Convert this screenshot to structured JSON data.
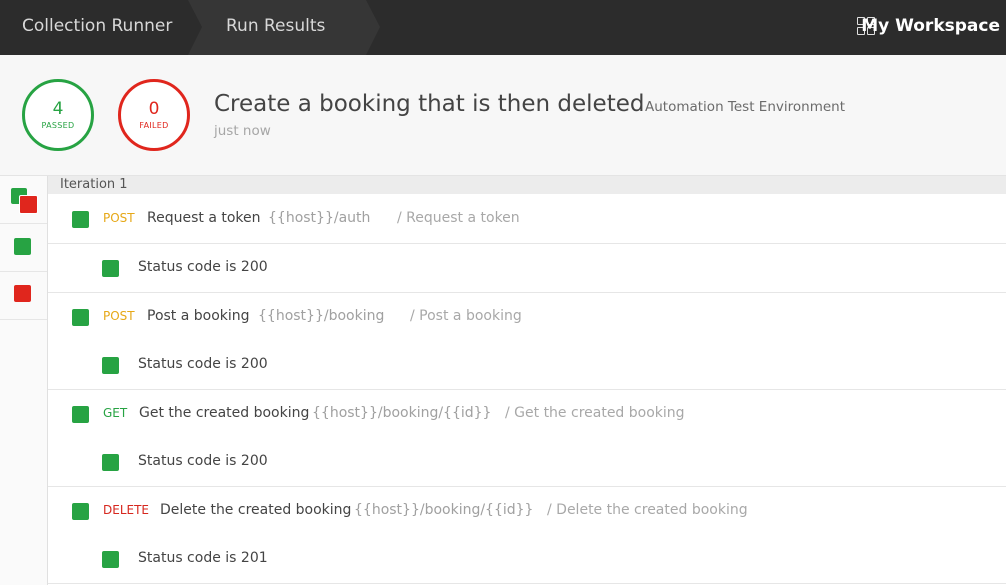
{
  "topbar": {
    "crumbs": [
      "Collection Runner",
      "Run Results"
    ],
    "workspace_icon": "grid-icon",
    "workspace": "My Workspace"
  },
  "summary": {
    "passed_count": "4",
    "passed_label": "PASSED",
    "failed_count": "0",
    "failed_label": "FAILED",
    "title": "Create a booking that is then deleted",
    "environment": "Automation Test Environment",
    "time": "just now"
  },
  "sidebar": {
    "iterations": [
      {
        "status": "passed"
      },
      {
        "status": "passed"
      },
      {
        "status": "failed"
      }
    ]
  },
  "iteration": {
    "label": "Iteration 1",
    "requests": [
      {
        "method": "POST",
        "name": "Request a token",
        "url": "{{host}}/auth",
        "path": "/ Request a token",
        "test": "Status code is 200"
      },
      {
        "method": "POST",
        "name": "Post a booking",
        "url": "{{host}}/booking",
        "path": "/ Post a booking",
        "test": "Status code is 200"
      },
      {
        "method": "GET",
        "name": "Get the created booking",
        "url": "{{host}}/booking/{{id}}",
        "path": "/ Get the created booking",
        "test": "Status code is 200"
      },
      {
        "method": "DELETE",
        "name": "Delete the created booking",
        "url": "{{host}}/booking/{{id}}",
        "path": "/ Delete the created booking",
        "test": "Status code is 201"
      }
    ]
  },
  "colors": {
    "pass": "#27a343",
    "fail": "#e0261d",
    "post": "#e6a817",
    "get": "#27a343",
    "delete": "#d6271e"
  }
}
